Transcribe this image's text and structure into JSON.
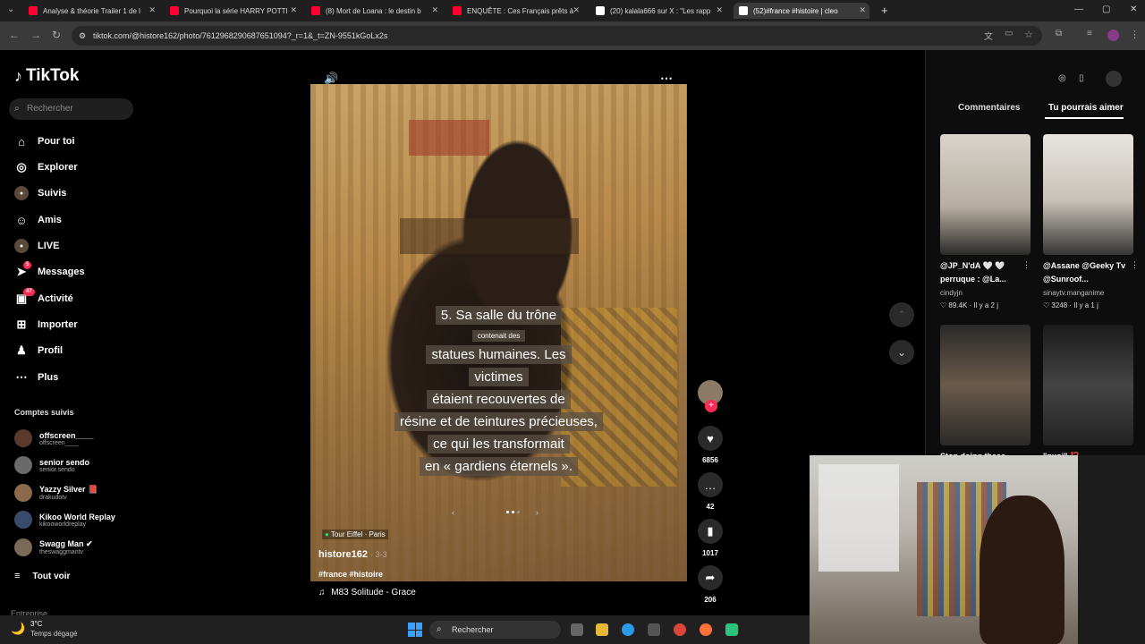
{
  "browser": {
    "tabs": [
      {
        "label": "Analyse & théorie Trailer 1 de l",
        "color": "#ff0033"
      },
      {
        "label": "Pourquoi la série HARRY POTTI",
        "color": "#ff0033"
      },
      {
        "label": "(8) Mort de Loana : le destin b",
        "color": "#ff0033"
      },
      {
        "label": "ENQUÊTE : Ces Français prêts à",
        "color": "#ff0033"
      },
      {
        "label": "(20) kalala666 sur X : \"Les rapp",
        "color": "#ffffff"
      },
      {
        "label": "(52)#france #histoire | cleo",
        "color": "#ffffff"
      }
    ],
    "new_tab": "+",
    "url": "tiktok.com/@histore162/photo/7612968290687651094?_r=1&_t=ZN-9551kGoLx2s"
  },
  "sidebar": {
    "logo": "TikTok",
    "search_placeholder": "Rechercher",
    "items": [
      {
        "label": "Pour toi",
        "icon": "home-icon"
      },
      {
        "label": "Explorer",
        "icon": "compass-icon"
      },
      {
        "label": "Suivis",
        "icon": "following-icon"
      },
      {
        "label": "Amis",
        "icon": "friends-icon"
      },
      {
        "label": "LIVE",
        "icon": "live-icon"
      },
      {
        "label": "Messages",
        "icon": "messages-icon",
        "badge": "5"
      },
      {
        "label": "Activité",
        "icon": "activity-icon",
        "badge": "47"
      },
      {
        "label": "Importer",
        "icon": "upload-icon"
      },
      {
        "label": "Profil",
        "icon": "profile-icon"
      },
      {
        "label": "Plus",
        "icon": "more-icon"
      }
    ],
    "following_title": "Comptes suivis",
    "accounts": [
      {
        "name": "offscreen____",
        "handle": "offscreen____"
      },
      {
        "name": "senior sendo",
        "handle": "senior.sendo"
      },
      {
        "name": "Yazzy Silver 📕",
        "handle": "drakudotv"
      },
      {
        "name": "Kikoo World Replay",
        "handle": "kikooworldreplay"
      },
      {
        "name": "Swagg Man ✔",
        "handle": "theswaggmantv"
      }
    ],
    "see_all": "Tout voir",
    "footer": "Entreprise"
  },
  "video": {
    "caption": [
      "5. Sa salle du trône",
      "contenait des",
      "statues humaines. Les",
      "victimes",
      "étaient recouvertes de",
      "résine et de teintures précieuses,",
      "ce qui les transformait",
      "en « gardiens éternels »."
    ],
    "location": "Tour Eiffel · Paris",
    "author": "histore162",
    "page": "· 3-3",
    "tags": "#france #histoire",
    "music": "M83 Solitude - Grace",
    "likes": "6856",
    "comments": "42",
    "saves": "1017",
    "shares": "206"
  },
  "rightpanel": {
    "tabs": [
      "Commentaires",
      "Tu pourrais aimer"
    ],
    "videos": [
      {
        "title": "@JP_N'dA 🤍 🤍 perruque : @La...",
        "user": "cindyjn",
        "stats": "♡ 89.4K · Il y a 2 j"
      },
      {
        "title": "@Assane @Geeky Tv @Sunroof...",
        "user": "sinaytv.manganime",
        "stats": "♡ 3248 · Il y a 1 j"
      },
      {
        "title": "Stop doing these...",
        "user": "",
        "stats": ""
      },
      {
        "title": "\"quoi\" ⁉️ ...",
        "user": "",
        "stats": ""
      }
    ]
  },
  "taskbar": {
    "weather_temp": "3°C",
    "weather_text": "Temps dégagé",
    "search": "Rechercher"
  }
}
